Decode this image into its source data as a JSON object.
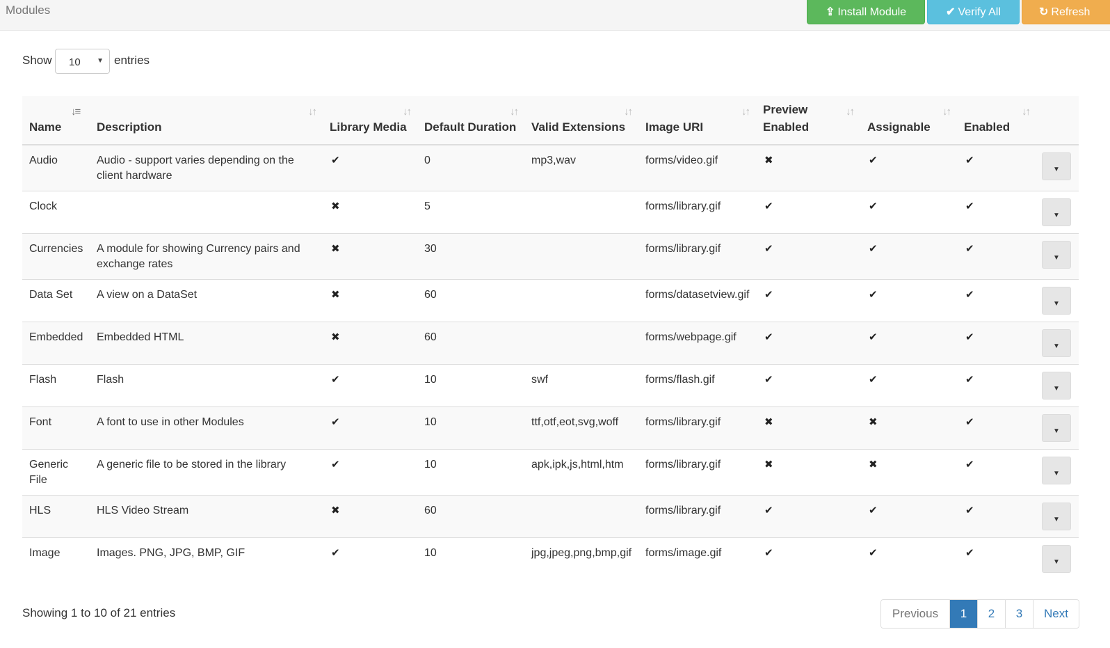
{
  "topbar": {
    "title": "Modules",
    "buttons": {
      "install": {
        "icon": "upload-icon",
        "label": "Install Module"
      },
      "verify": {
        "icon": "check-circle-icon",
        "label": "Verify All"
      },
      "refresh": {
        "icon": "refresh-icon",
        "label": "Refresh"
      }
    }
  },
  "length_menu": {
    "show_label": "Show",
    "selected": "10",
    "entries_label": "entries"
  },
  "table": {
    "headers": {
      "name": "Name",
      "description": "Description",
      "library_media": "Library Media",
      "default_duration": "Default Duration",
      "valid_extensions": "Valid Extensions",
      "image_uri": "Image URI",
      "preview_enabled": "Preview Enabled",
      "assignable": "Assignable",
      "enabled": "Enabled"
    },
    "rows": [
      {
        "name": "Audio",
        "description": "Audio - support varies depending on the client hardware",
        "library_media": "✔",
        "default_duration": "0",
        "valid_extensions": "mp3,wav",
        "image_uri": "forms/video.gif",
        "preview_enabled": "✖",
        "assignable": "✔",
        "enabled": "✔"
      },
      {
        "name": "Clock",
        "description": "",
        "library_media": "✖",
        "default_duration": "5",
        "valid_extensions": "",
        "image_uri": "forms/library.gif",
        "preview_enabled": "✔",
        "assignable": "✔",
        "enabled": "✔"
      },
      {
        "name": "Currencies",
        "description": "A module for showing Currency pairs and exchange rates",
        "library_media": "✖",
        "default_duration": "30",
        "valid_extensions": "",
        "image_uri": "forms/library.gif",
        "preview_enabled": "✔",
        "assignable": "✔",
        "enabled": "✔"
      },
      {
        "name": "Data Set",
        "description": "A view on a DataSet",
        "library_media": "✖",
        "default_duration": "60",
        "valid_extensions": "",
        "image_uri": "forms/datasetview.gif",
        "preview_enabled": "✔",
        "assignable": "✔",
        "enabled": "✔"
      },
      {
        "name": "Embedded",
        "description": "Embedded HTML",
        "library_media": "✖",
        "default_duration": "60",
        "valid_extensions": "",
        "image_uri": "forms/webpage.gif",
        "preview_enabled": "✔",
        "assignable": "✔",
        "enabled": "✔"
      },
      {
        "name": "Flash",
        "description": "Flash",
        "library_media": "✔",
        "default_duration": "10",
        "valid_extensions": "swf",
        "image_uri": "forms/flash.gif",
        "preview_enabled": "✔",
        "assignable": "✔",
        "enabled": "✔"
      },
      {
        "name": "Font",
        "description": "A font to use in other Modules",
        "library_media": "✔",
        "default_duration": "10",
        "valid_extensions": "ttf,otf,eot,svg,woff",
        "image_uri": "forms/library.gif",
        "preview_enabled": "✖",
        "assignable": "✖",
        "enabled": "✔"
      },
      {
        "name": "Generic File",
        "description": "A generic file to be stored in the library",
        "library_media": "✔",
        "default_duration": "10",
        "valid_extensions": "apk,ipk,js,html,htm",
        "image_uri": "forms/library.gif",
        "preview_enabled": "✖",
        "assignable": "✖",
        "enabled": "✔"
      },
      {
        "name": "HLS",
        "description": "HLS Video Stream",
        "library_media": "✖",
        "default_duration": "60",
        "valid_extensions": "",
        "image_uri": "forms/library.gif",
        "preview_enabled": "✔",
        "assignable": "✔",
        "enabled": "✔"
      },
      {
        "name": "Image",
        "description": "Images. PNG, JPG, BMP, GIF",
        "library_media": "✔",
        "default_duration": "10",
        "valid_extensions": "jpg,jpeg,png,bmp,gif",
        "image_uri": "forms/image.gif",
        "preview_enabled": "✔",
        "assignable": "✔",
        "enabled": "✔"
      }
    ]
  },
  "footer": {
    "info": "Showing 1 to 10 of 21 entries",
    "pagination": {
      "previous": "Previous",
      "pages": [
        "1",
        "2",
        "3"
      ],
      "active_page": "1",
      "next": "Next"
    }
  }
}
